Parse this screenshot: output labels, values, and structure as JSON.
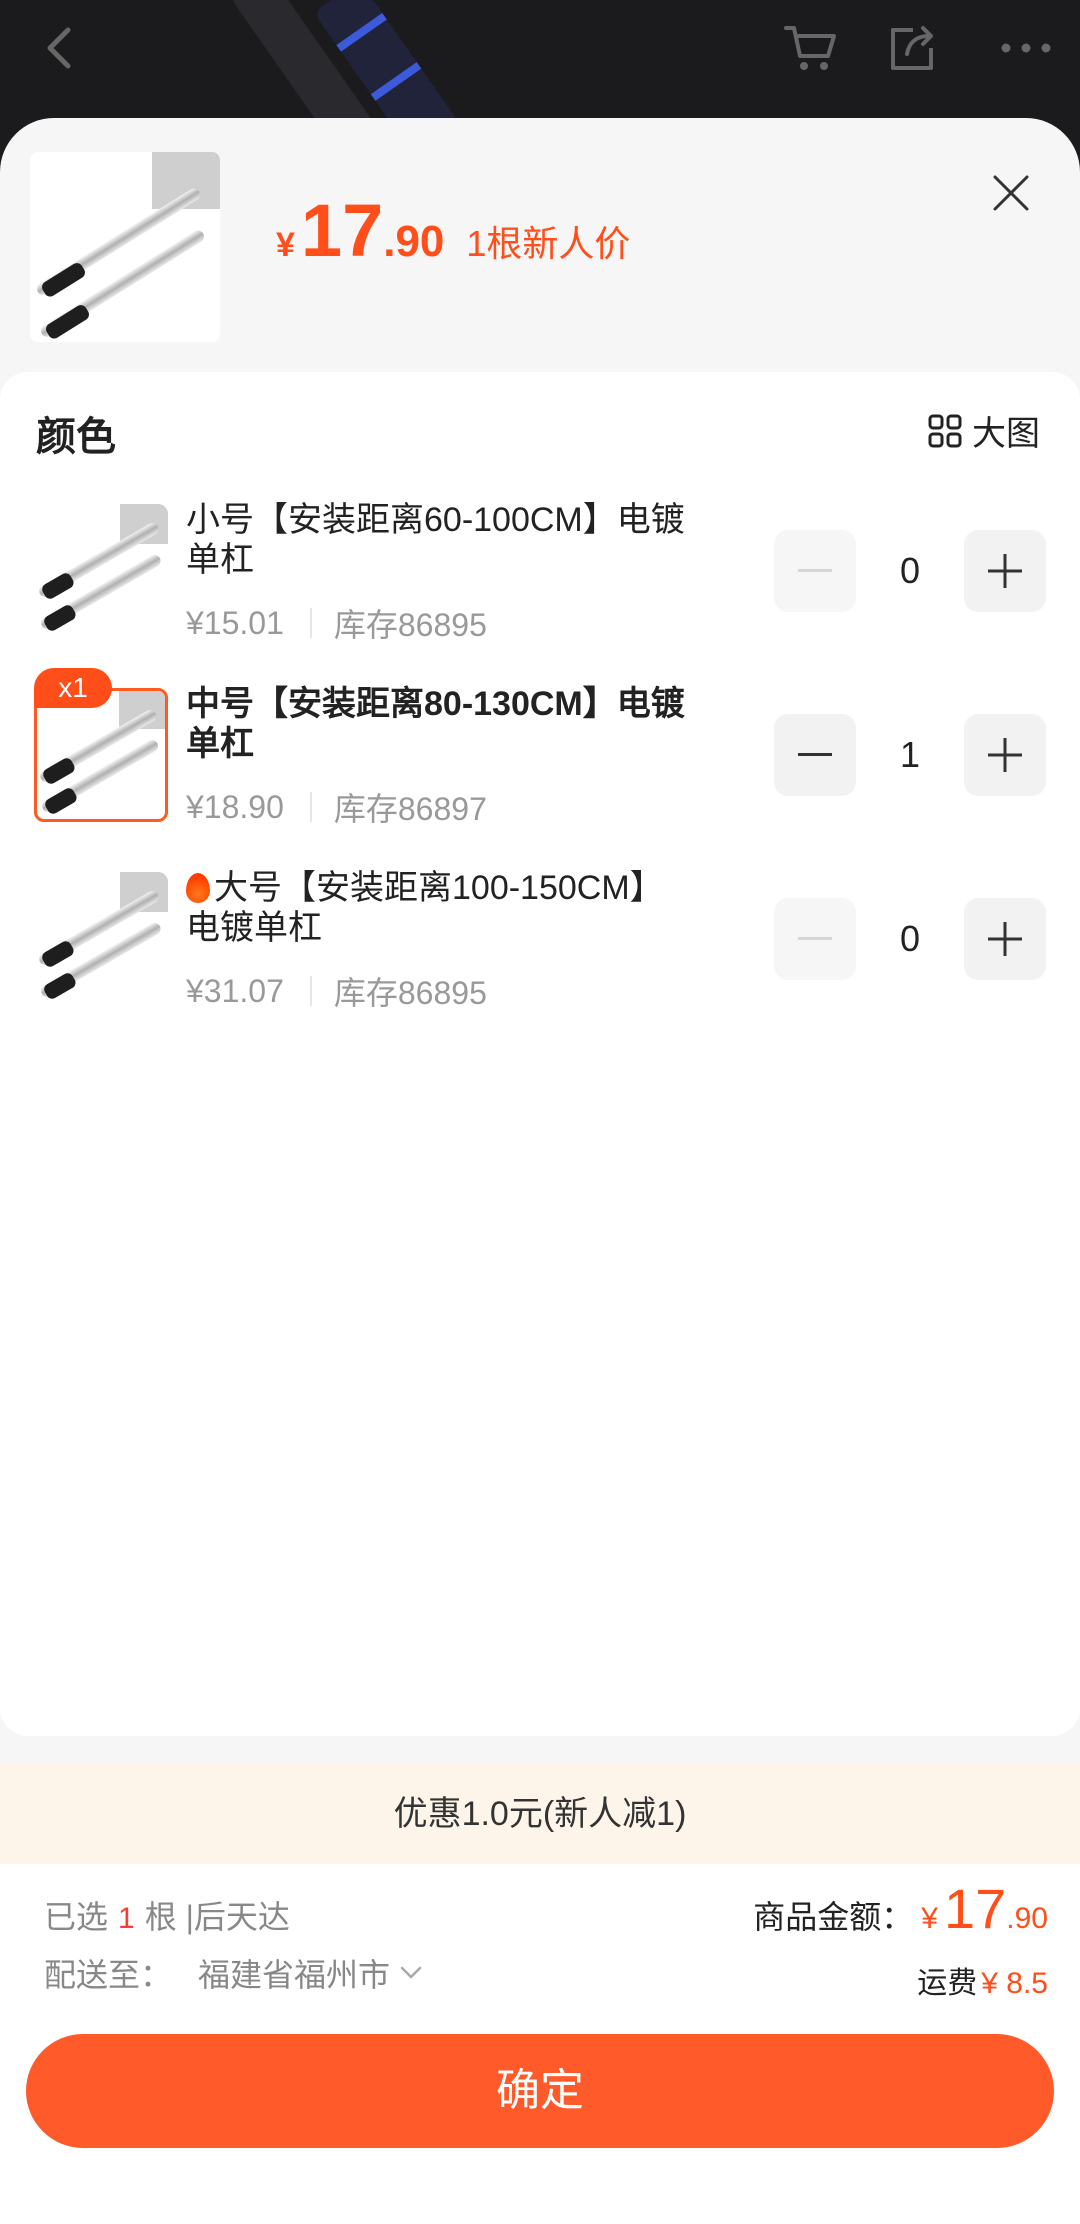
{
  "background_nav": {
    "back_icon": "chevron-left-icon",
    "cart_icon": "cart-icon",
    "share_icon": "share-icon",
    "more_icon": "more-dots-icon"
  },
  "header": {
    "currency": "¥",
    "price_integer": "17",
    "price_decimal": ".90",
    "price_tag": "1根新人价",
    "close_icon": "close-icon"
  },
  "section": {
    "title": "颜色",
    "bigpic_label": "大图",
    "bigpic_icon": "grid-icon"
  },
  "variants": [
    {
      "name": "小号【安装距离60-100CM】电镀单杠",
      "price": "¥15.01",
      "stock": "库存86895",
      "quantity": "0",
      "selected": false,
      "badge": ""
    },
    {
      "name": "中号【安装距离80-130CM】电镀单杠",
      "price": "¥18.90",
      "stock": "库存86897",
      "quantity": "1",
      "selected": true,
      "badge": "x1"
    },
    {
      "name": "大号【安装距离100-150CM】电镀单杠",
      "price": "¥31.07",
      "stock": "库存86895",
      "quantity": "0",
      "selected": false,
      "badge": "",
      "hot": true
    }
  ],
  "promo": {
    "text": "优惠1.0元(新人减1)"
  },
  "footer": {
    "selected_prefix": "已选",
    "selected_qty": "1",
    "selected_suffix": "根 |后天达",
    "amount_label": "商品金额：",
    "amount_currency": "¥",
    "amount_integer": "17",
    "amount_decimal": ".90",
    "deliver_label": "配送至：",
    "deliver_address": "福建省福州市",
    "freight_label": "运费",
    "freight_value": "¥ 8.5",
    "confirm_label": "确定"
  },
  "colors": {
    "accent": "#ff5a2a",
    "price": "#ff4e1a",
    "promo_bg": "#fdf5ea"
  }
}
